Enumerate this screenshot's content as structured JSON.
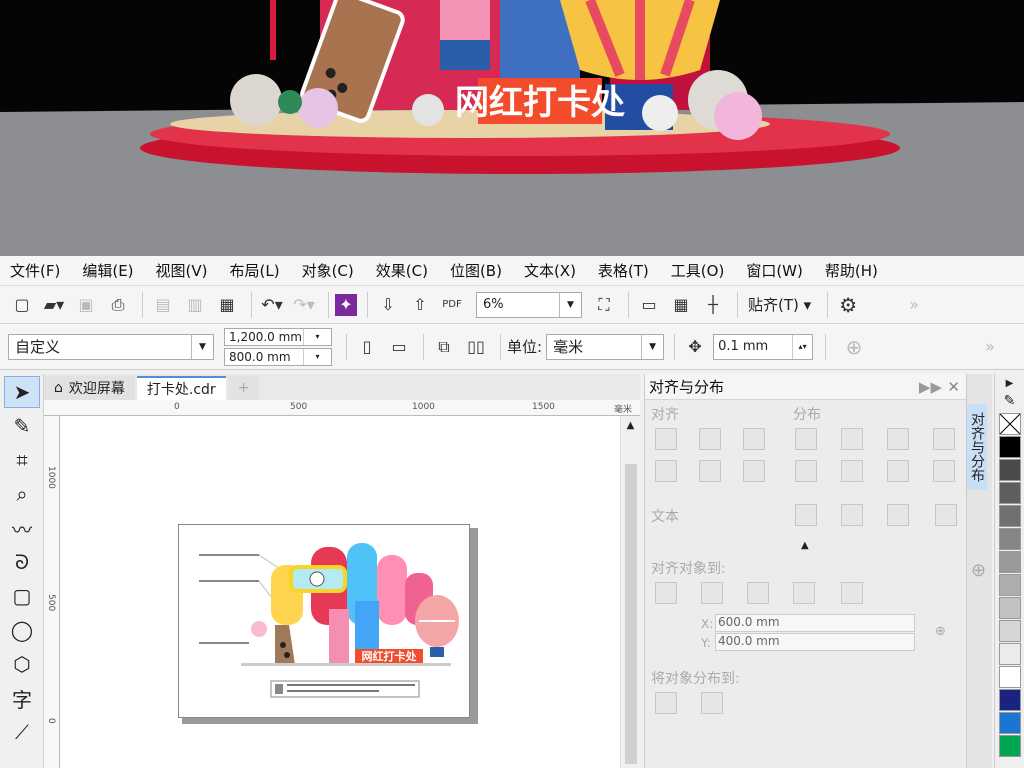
{
  "menu": [
    "文件(F)",
    "编辑(E)",
    "视图(V)",
    "布局(L)",
    "对象(C)",
    "效果(C)",
    "位图(B)",
    "文本(X)",
    "表格(T)",
    "工具(O)",
    "窗口(W)",
    "帮助(H)"
  ],
  "toolbar": {
    "zoom": "6%",
    "snap_label": "贴齐(T)",
    "pdf_label": "PDF"
  },
  "propbar": {
    "preset": "自定义",
    "width": "1,200.0 mm",
    "height": "800.0 mm",
    "units_label": "单位:",
    "units": "毫米",
    "nudge": "0.1 mm"
  },
  "tabs": [
    "欢迎屏幕",
    "打卡处.cdr"
  ],
  "ruler_h": [
    "0",
    "500",
    "1000",
    "1500",
    "毫米"
  ],
  "ruler_v": [
    "1000",
    "500",
    "0"
  ],
  "scene_sign": "网红打卡处",
  "artboard": {
    "sign": "网红打卡处"
  },
  "panel": {
    "title": "对齐与分布",
    "align": "对齐",
    "distribute": "分布",
    "text": "文本",
    "align_to": "对齐对象到:",
    "x_label": "X:",
    "y_label": "Y:",
    "x": "600.0 mm",
    "y": "400.0 mm",
    "distribute_to": "将对象分布到:"
  },
  "vtab_label": "对齐与分布",
  "palette_colors": [
    "#ffffff",
    "#000000",
    "#4a4a4a",
    "#5e5e5e",
    "#707070",
    "#858585",
    "#999999",
    "#adadad",
    "#c2c2c2",
    "#d6d6d6",
    "#ebebeb",
    "#ffffff",
    "#1a237e",
    "#1976d2",
    "#00a651"
  ]
}
